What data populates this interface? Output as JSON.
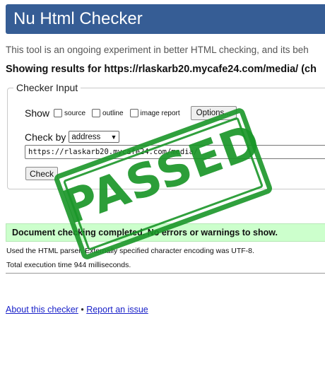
{
  "header": {
    "title": "Nu Html Checker"
  },
  "intro": {
    "text": "This tool is an ongoing experiment in better HTML checking, and its beh"
  },
  "results": {
    "prefix": "Showing results for ",
    "url": "https://rlaskarb20.mycafe24.com/media/ (ch"
  },
  "checker_input": {
    "legend": "Checker Input",
    "show_label": "Show",
    "options": [
      {
        "label": "source",
        "checked": false
      },
      {
        "label": "outline",
        "checked": false
      },
      {
        "label": "image report",
        "checked": false
      }
    ],
    "options_button": "Options...",
    "check_by_label": "Check by",
    "check_by_value": "address",
    "url_value": "https://rlaskarb20.mycafe24.com/media/",
    "check_button": "Check"
  },
  "stamp": {
    "text": "PASSED",
    "color": "#1a9628"
  },
  "status": {
    "success_message": "Document checking completed. No errors or warnings to show.",
    "info_parser": "Used the HTML parser. Externally specified character encoding was UTF-8.",
    "info_time": "Total execution time 944 milliseconds."
  },
  "footer": {
    "about_link": "About this checker",
    "separator": "•",
    "report_link": "Report an issue"
  },
  "colors": {
    "title_bar": "#365d95",
    "success_bg": "#ccffcc",
    "link": "#1a22c9"
  }
}
